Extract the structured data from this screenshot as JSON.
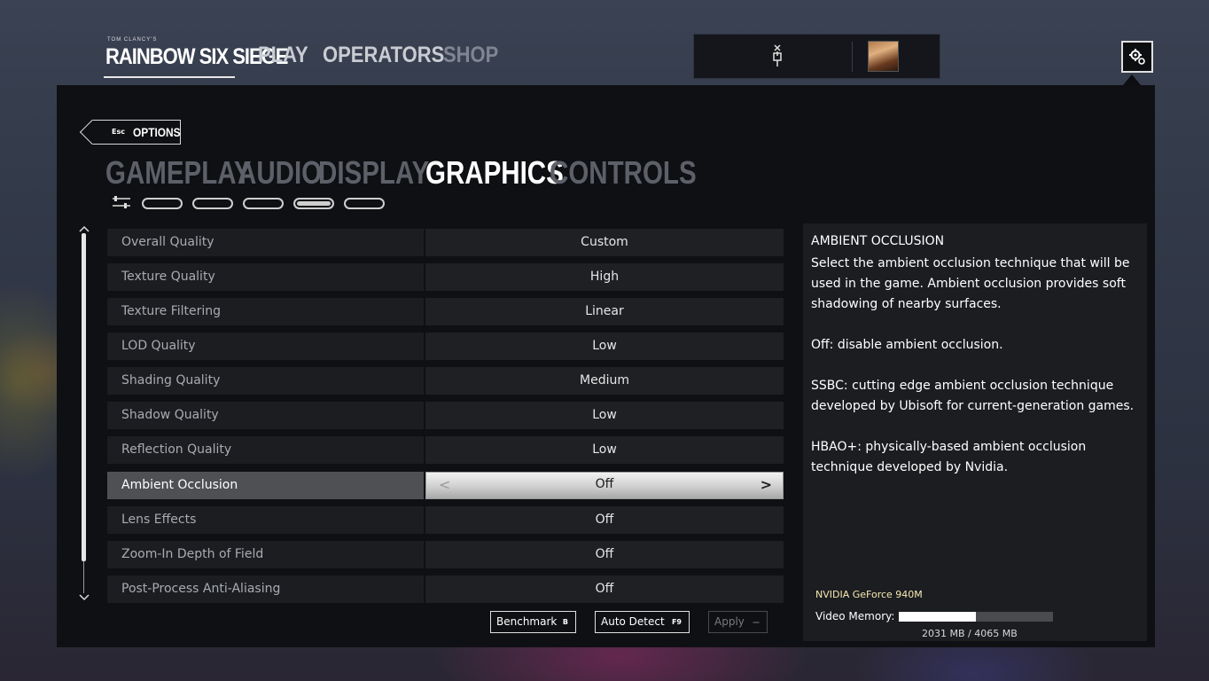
{
  "brand": {
    "small": "TOM CLANCY'S",
    "main": "RAINBOW SIX SIEGE"
  },
  "nav": {
    "play": "PLAY",
    "operators": "OPERATORS",
    "shop": "SHOP"
  },
  "icons": {
    "squad_link": "unlink-icon",
    "avatar": "operator-avatar",
    "settings": "gear-icon",
    "subtab_presets": "sliders-icon"
  },
  "back": {
    "key": "Esc",
    "label": "OPTIONS"
  },
  "tabs": [
    "GAMEPLAY",
    "AUDIO",
    "DISPLAY",
    "GRAPHICS",
    "CONTROLS"
  ],
  "active_tab": "GRAPHICS",
  "subtab_count": 5,
  "active_subtab": 4,
  "settings": [
    {
      "name": "Overall Quality",
      "value": "Custom"
    },
    {
      "name": "Texture Quality",
      "value": "High"
    },
    {
      "name": "Texture Filtering",
      "value": "Linear"
    },
    {
      "name": "LOD Quality",
      "value": "Low"
    },
    {
      "name": "Shading Quality",
      "value": "Medium"
    },
    {
      "name": "Shadow Quality",
      "value": "Low"
    },
    {
      "name": "Reflection Quality",
      "value": "Low"
    },
    {
      "name": "Ambient Occlusion",
      "value": "Off",
      "selected": true,
      "option_count": 3,
      "option_index": 1
    },
    {
      "name": "Lens Effects",
      "value": "Off"
    },
    {
      "name": "Zoom-In Depth of Field",
      "value": "Off"
    },
    {
      "name": "Post-Process Anti-Aliasing",
      "value": "Off"
    }
  ],
  "selector": {
    "left": "<",
    "right": ">"
  },
  "buttons": {
    "benchmark": {
      "label": "Benchmark",
      "key": "B"
    },
    "auto_detect": {
      "label": "Auto Detect",
      "key": "F9"
    },
    "apply": {
      "label": "Apply",
      "key": "—"
    }
  },
  "info": {
    "title": "AMBIENT OCCLUSION",
    "paragraphs": [
      "Select the ambient occlusion technique that will be used in the game. Ambient occlusion provides soft shadowing of nearby surfaces.",
      "Off: disable ambient occlusion.",
      "SSBC: cutting edge ambient occlusion technique developed by Ubisoft for current-generation games.",
      "HBAO+: physically-based ambient occlusion technique developed by Nvidia."
    ],
    "gpu": "NVIDIA GeForce 940M",
    "memory_label": "Video Memory:",
    "memory_used_fraction": 0.4996,
    "memory_text": "2031 MB / 4065 MB"
  }
}
